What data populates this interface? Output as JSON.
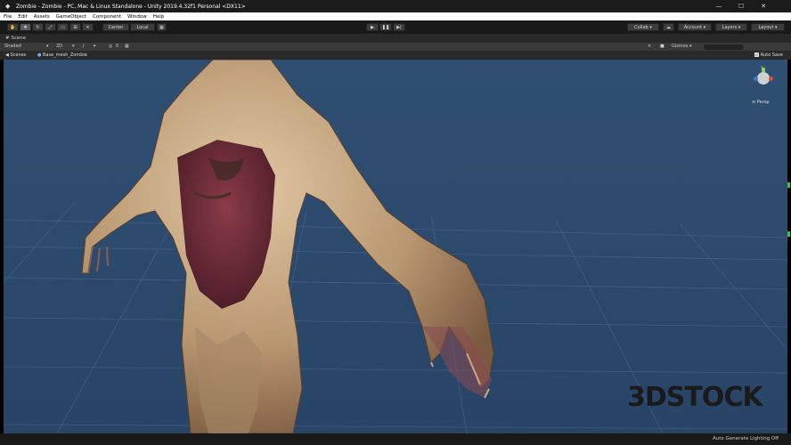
{
  "window": {
    "title": "Zombie - Zombie - PC, Mac & Linux Standalone - Unity 2019.4.32f1 Personal <DX11>"
  },
  "menu": [
    "File",
    "Edit",
    "Assets",
    "GameObject",
    "Component",
    "Window",
    "Help"
  ],
  "toolbar": {
    "pivot": "Center",
    "space": "Local",
    "collab": "Collab",
    "account": "Account",
    "layers": "Layers",
    "layout": "Layout"
  },
  "scene_tab": {
    "label": "Scene"
  },
  "scene_toolbar": {
    "draw_mode": "Shaded",
    "mode_2d": "2D",
    "fx_count": "0",
    "gizmos": "Gizmos"
  },
  "breadcrumb": {
    "scenes": "Scenes",
    "object": "Base_mesh_Zombie",
    "auto_save": "Auto Save"
  },
  "gizmo": {
    "axis": "y",
    "projection": "Persp"
  },
  "watermark": "3DSTOCK",
  "status": {
    "lighting": "Auto Generate Lighting Off"
  },
  "colors": {
    "sky": "#2c4a6c",
    "grid": "#4a6a8c",
    "skin": "#c9a784",
    "flesh": "#6a2a35"
  }
}
